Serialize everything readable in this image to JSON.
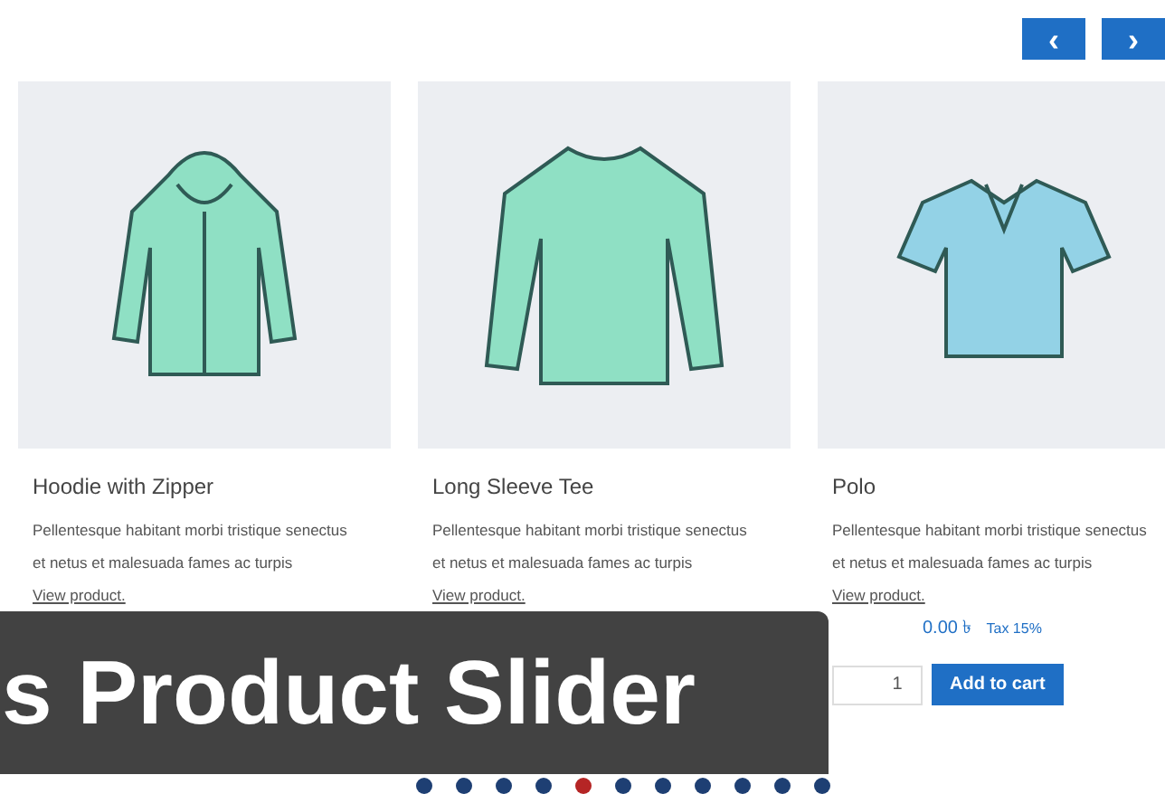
{
  "nav_buttons": [
    {
      "label": "‹"
    },
    {
      "label": "›"
    }
  ],
  "products": [
    {
      "kind": "hoodie",
      "name": "Hoodie with Zipper",
      "description": "Pellentesque habitant morbi tristique senectus et netus et malesuada fames ac turpis",
      "link": "View product."
    },
    {
      "kind": "tee",
      "name": "Long Sleeve Tee",
      "description": "Pellentesque habitant morbi tristique senectus et netus et malesuada fames ac turpis",
      "link": "View product."
    },
    {
      "kind": "polo",
      "name": "Polo",
      "description": "Pellentesque habitant morbi tristique senectus et netus et malesuada fames ac turpis",
      "link": "View product.",
      "price": "0.00 ৳",
      "tax": "Tax 15%",
      "quantity": "1",
      "button": "Add to cart"
    }
  ],
  "banner": {
    "title": "s Product Slider"
  },
  "dots": [
    {
      "selected": false
    },
    {
      "selected": false
    },
    {
      "selected": false
    },
    {
      "selected": false
    },
    {
      "selected": true
    },
    {
      "selected": false
    },
    {
      "selected": false
    },
    {
      "selected": false
    },
    {
      "selected": false
    },
    {
      "selected": false
    },
    {
      "selected": false
    }
  ]
}
